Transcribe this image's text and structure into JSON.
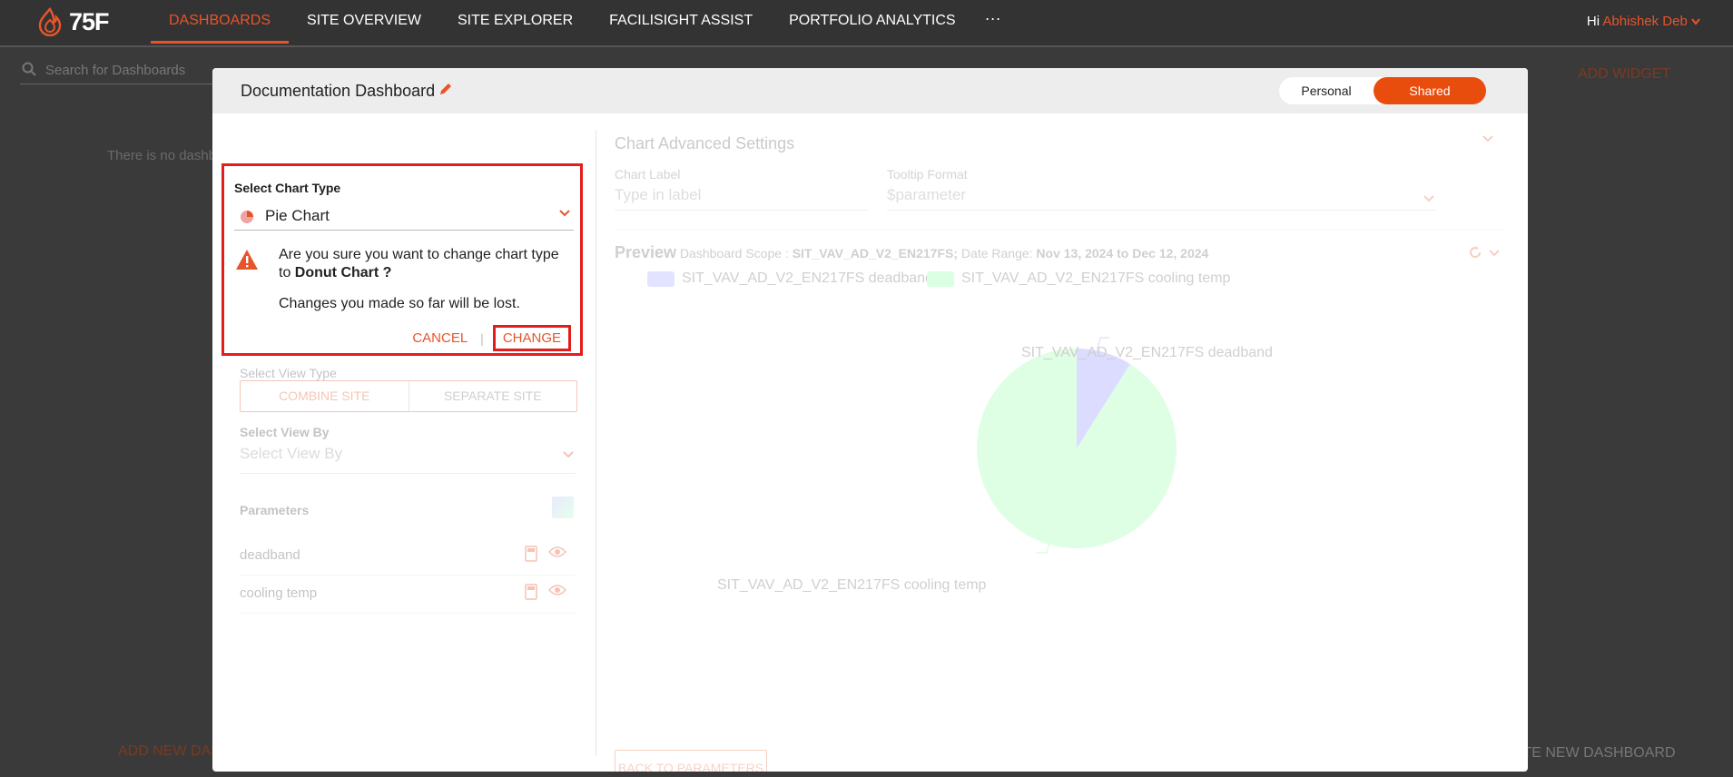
{
  "nav": {
    "logo": "75F",
    "items": [
      "DASHBOARDS",
      "SITE OVERVIEW",
      "SITE EXPLORER",
      "FACILISIGHT ASSIST",
      "PORTFOLIO ANALYTICS"
    ],
    "more": "···",
    "greeting": "Hi",
    "user_name": "Abhishek Deb"
  },
  "background": {
    "search_placeholder": "Search for Dashboards",
    "empty_text": "There is no dashb",
    "add_widget": "ADD WIDGET",
    "add_new_dashboard": "ADD NEW DAS",
    "create_new_dashboard": "ATE NEW DASHBOARD"
  },
  "modal": {
    "title": "Documentation Dashboard",
    "toggle": {
      "personal": "Personal",
      "shared": "Shared"
    }
  },
  "left": {
    "select_chart_type_label": "Select Chart Type",
    "chart_type_value": "Pie Chart",
    "confirm": {
      "line1_pre": "Are you sure you want to change chart type to",
      "target": "Donut Chart ?",
      "line2": "Changes you made so far will be lost.",
      "cancel": "CANCEL",
      "separator": "|",
      "change": "CHANGE"
    },
    "select_view_type_label": "Select View Type",
    "combine_site": "COMBINE SITE",
    "separate_site": "SEPARATE SITE",
    "select_view_by_label": "Select View By",
    "select_view_by_placeholder": "Select View By",
    "parameters_label": "Parameters",
    "parameters": [
      "deadband",
      "cooling temp"
    ]
  },
  "right": {
    "advanced_title": "Chart Advanced Settings",
    "chart_label_label": "Chart Label",
    "chart_label_placeholder": "Type in label",
    "tooltip_label": "Tooltip Format",
    "tooltip_value": "$parameter",
    "preview_title": "Preview",
    "scope_label": "Dashboard Scope :",
    "scope_value": "SIT_VAV_AD_V2_EN217FS;",
    "date_label": "Date Range:",
    "date_value": "Nov 13, 2024 to Dec 12, 2024",
    "back_button": "BACK TO PARAMETERS"
  },
  "colors": {
    "accent": "#e8542a",
    "series1": "#c9ccff",
    "series2": "#c8ffd2"
  },
  "chart_data": {
    "type": "pie",
    "categories": [
      "SIT_VAV_AD_V2_EN217FS deadband",
      "SIT_VAV_AD_V2_EN217FS cooling temp"
    ],
    "values": [
      9,
      91
    ],
    "legend": "top-left"
  }
}
